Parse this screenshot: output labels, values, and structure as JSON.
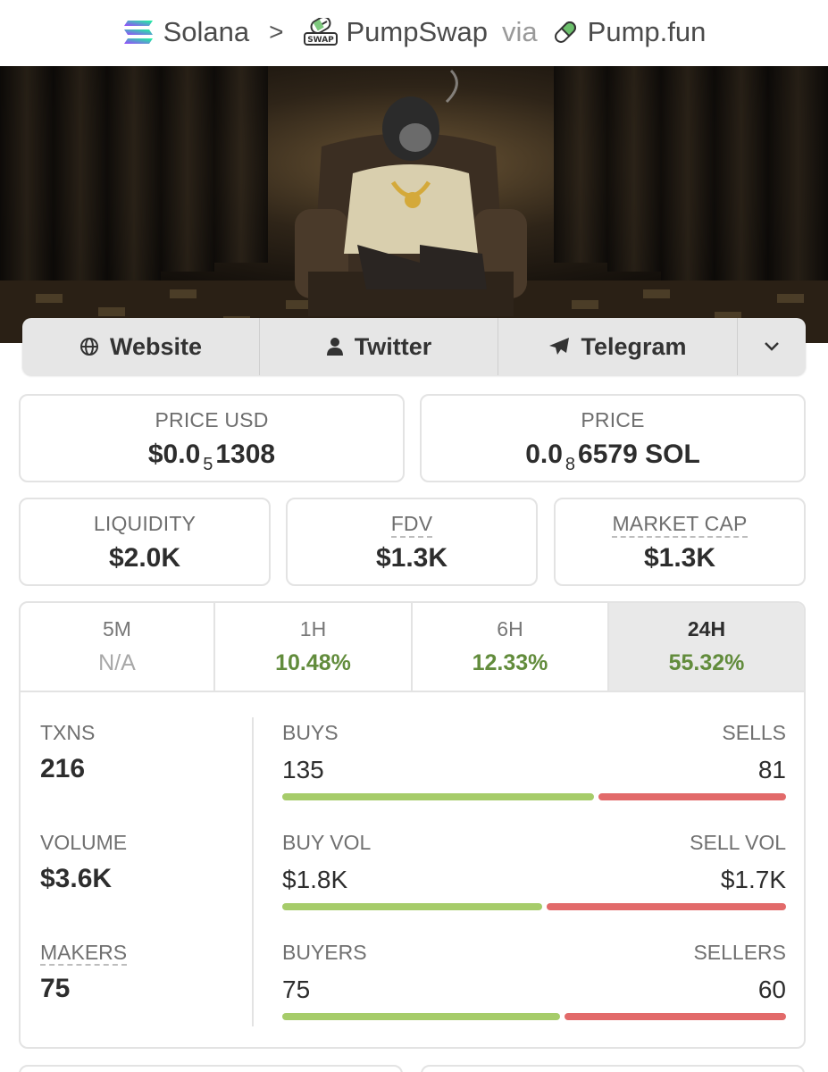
{
  "breadcrumb": {
    "chain": "Solana",
    "separator": ">",
    "dex": "PumpSwap",
    "dex_badge": "SWAP",
    "via": "via",
    "launchpad": "Pump.fun"
  },
  "socials": {
    "website": "Website",
    "twitter": "Twitter",
    "telegram": "Telegram"
  },
  "price_usd": {
    "label": "PRICE USD",
    "prefix": "$0.0",
    "zeros": "5",
    "digits": "1308"
  },
  "price_native": {
    "label": "PRICE",
    "prefix": "0.0",
    "zeros": "8",
    "digits": "6579 SOL"
  },
  "liquidity": {
    "label": "LIQUIDITY",
    "value": "$2.0K"
  },
  "fdv": {
    "label": "FDV",
    "value": "$1.3K"
  },
  "market_cap": {
    "label": "MARKET CAP",
    "value": "$1.3K"
  },
  "timeframes": [
    {
      "label": "5M",
      "value": "N/A",
      "active": false
    },
    {
      "label": "1H",
      "value": "10.48%",
      "active": false
    },
    {
      "label": "6H",
      "value": "12.33%",
      "active": false
    },
    {
      "label": "24H",
      "value": "55.32%",
      "active": true
    }
  ],
  "txns": {
    "label": "TXNS",
    "value": "216"
  },
  "volume": {
    "label": "VOLUME",
    "value": "$3.6K"
  },
  "makers": {
    "label": "MAKERS",
    "value": "75"
  },
  "buys_sells": {
    "left_label": "BUYS",
    "right_label": "SELLS",
    "left": "135",
    "right": "81",
    "buy_fraction": 0.625
  },
  "vol_split": {
    "left_label": "BUY VOL",
    "right_label": "SELL VOL",
    "left": "$1.8K",
    "right": "$1.7K",
    "buy_fraction": 0.52
  },
  "buyers_sellers": {
    "left_label": "BUYERS",
    "right_label": "SELLERS",
    "left": "75",
    "right": "60",
    "buy_fraction": 0.556
  },
  "colors": {
    "positive": "#628c3c",
    "buy_bar": "#a6cc6a",
    "sell_bar": "#e26a6a"
  }
}
